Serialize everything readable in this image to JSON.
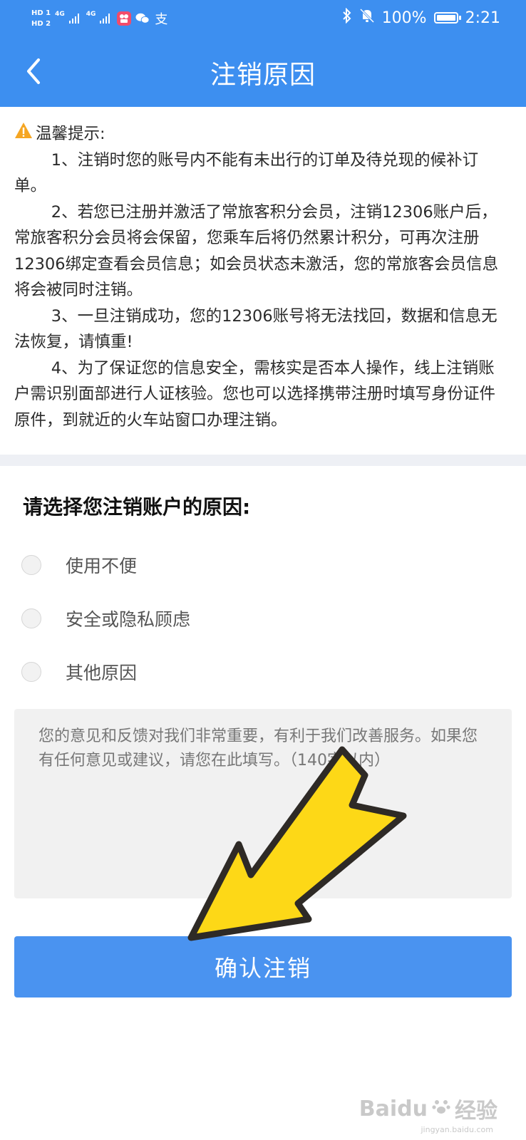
{
  "status_bar": {
    "hd1": "HD 1",
    "hd2": "HD 2",
    "network1": "4G",
    "network2": "4G",
    "app_icon_alipay": "支",
    "battery_percent": "100%",
    "time": "2:21"
  },
  "header": {
    "title": "注销原因",
    "background_color": "#3d8ff0"
  },
  "notice": {
    "title": "温馨提示:",
    "paragraphs": [
      "1、注销时您的账号内不能有未出行的订单及待兑现的候补订单。",
      "2、若您已注册并激活了常旅客积分会员，注销12306账户后，常旅客积分会员将会保留，您乘车后将仍然累计积分，可再次注册12306绑定查看会员信息；如会员状态未激活，您的常旅客会员信息将会被同时注销。",
      "3、一旦注销成功，您的12306账号将无法找回，数据和信息无法恢复，请慎重!",
      "4、为了保证您的信息安全，需核实是否本人操作，线上注销账户需识别面部进行人证核验。您也可以选择携带注册时填写身份证件原件，到就近的火车站窗口办理注销。"
    ]
  },
  "reasons": {
    "heading": "请选择您注销账户的原因:",
    "options": [
      {
        "label": "使用不便",
        "selected": false
      },
      {
        "label": "安全或隐私顾虑",
        "selected": false
      },
      {
        "label": "其他原因",
        "selected": false
      }
    ]
  },
  "feedback": {
    "placeholder": "您的意见和反馈对我们非常重要，有利于我们改善服务。如果您有任何意见或建议，请您在此填写。（140字以内）",
    "value": ""
  },
  "confirm_button": {
    "label": "确认注销",
    "color": "#4a93f0"
  },
  "annotation": {
    "arrow_color": "#fdd817"
  },
  "watermark": {
    "brand": "Baidu",
    "text": "经验",
    "url": "jingyan.baidu.com"
  }
}
